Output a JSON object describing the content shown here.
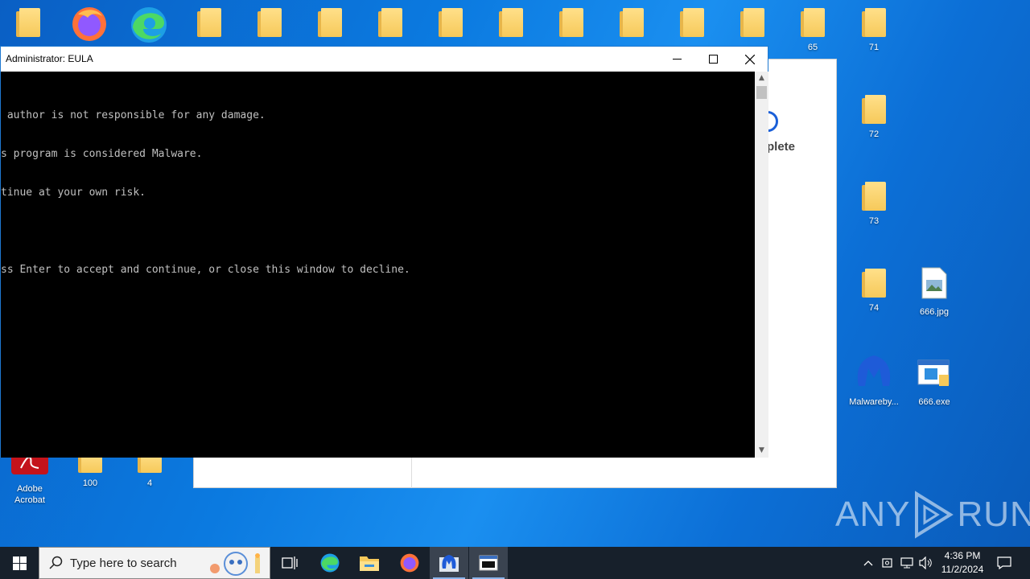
{
  "desktop": {
    "top_row_labels": [
      "",
      "",
      "",
      "",
      "",
      "",
      "",
      "",
      "",
      "",
      "",
      "",
      "",
      "65",
      "71"
    ],
    "right_icons": [
      {
        "label": "72"
      },
      {
        "label": "73"
      },
      {
        "label": "74"
      },
      {
        "label": "666.jpg"
      },
      {
        "label": "Malwareby..."
      },
      {
        "label": "666.exe"
      }
    ],
    "bottom_icons": [
      {
        "label": "Adobe Acrobat"
      },
      {
        "label": "100"
      },
      {
        "label": "4"
      }
    ]
  },
  "background_window": {
    "partial_text": "plete"
  },
  "console": {
    "title": "Administrator:  EULA",
    "lines": [
      " author is not responsible for any damage.",
      "s program is considered Malware.",
      "tinue at your own risk.",
      "",
      "ss Enter to accept and continue, or close this window to decline."
    ]
  },
  "watermark": {
    "left": "ANY",
    "right": "RUN"
  },
  "taskbar": {
    "search_placeholder": "Type here to search",
    "time": "4:36 PM",
    "date": "11/2/2024"
  },
  "colors": {
    "desktop_blue": "#0b7ae0",
    "taskbar": "#17202b",
    "console_bg": "#000000",
    "console_text": "#c0c0c0"
  }
}
